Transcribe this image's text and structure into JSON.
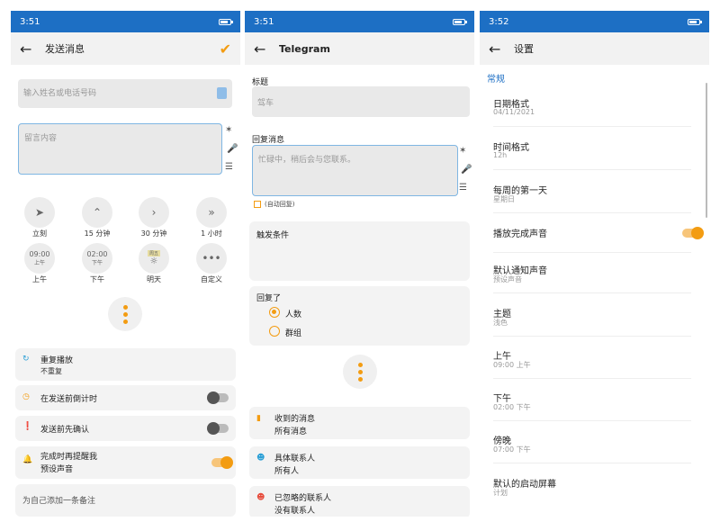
{
  "panel1": {
    "status_time": "3:51",
    "title": "发送消息",
    "contact_placeholder": "输入姓名或电话号码",
    "message_placeholder": "留言内容",
    "quick": [
      {
        "icon": "send-icon",
        "label": "立刻"
      },
      {
        "icon": "chevron-up-icon",
        "label": "15 分钟"
      },
      {
        "icon": "chevron-right-icon",
        "label": "30 分钟"
      },
      {
        "icon": "double-chevron-icon",
        "label": "1 小时"
      }
    ],
    "presets": [
      {
        "time": "09:00",
        "badge": "上午",
        "label": "上午"
      },
      {
        "time": "02:00",
        "badge": "下午",
        "label": "下午"
      },
      {
        "time": "",
        "badge": "周五",
        "label": "明天"
      },
      {
        "time": "•••",
        "badge": "",
        "label": "自定义"
      }
    ],
    "repeat": {
      "title": "重复播放",
      "value": "不重复"
    },
    "countdown": "在发送前倒计时",
    "confirm": "发送前先确认",
    "remind": {
      "title": "完成时再提醒我",
      "value": "预设声音"
    },
    "note_placeholder": "为自己添加一条备注"
  },
  "panel2": {
    "status_time": "3:51",
    "title": "Telegram",
    "title_label": "标题",
    "title_value": "驾车",
    "reply_label": "回复消息",
    "reply_value": "忙碌中，稍后会与您联系。",
    "auto_reply": "(自动回复)",
    "trigger_label": "触发条件",
    "replied_label": "回复了",
    "opt_people": "人数",
    "opt_group": "群组",
    "received": {
      "title": "收到的消息",
      "value": "所有消息"
    },
    "contacts": {
      "title": "具体联系人",
      "value": "所有人"
    },
    "ignored": {
      "title": "已忽略的联系人",
      "value": "没有联系人"
    }
  },
  "panel3": {
    "status_time": "3:52",
    "title": "设置",
    "section": "常规",
    "items": [
      {
        "label": "日期格式",
        "value": "04/11/2021"
      },
      {
        "label": "时间格式",
        "value": "12h"
      },
      {
        "label": "每周的第一天",
        "value": "星期日"
      },
      {
        "label": "播放完成声音",
        "value": ""
      },
      {
        "label": "默认通知声音",
        "value": "预设声音"
      },
      {
        "label": "主题",
        "value": "浅色"
      },
      {
        "label": "上午",
        "value": "09:00 上午"
      },
      {
        "label": "下午",
        "value": "02:00 下午"
      },
      {
        "label": "傍晚",
        "value": "07:00 下午"
      },
      {
        "label": "默认的启动屏幕",
        "value": "计划"
      }
    ]
  },
  "colors": {
    "statusbar": "#1d6fc4",
    "accent": "#f39c12"
  }
}
